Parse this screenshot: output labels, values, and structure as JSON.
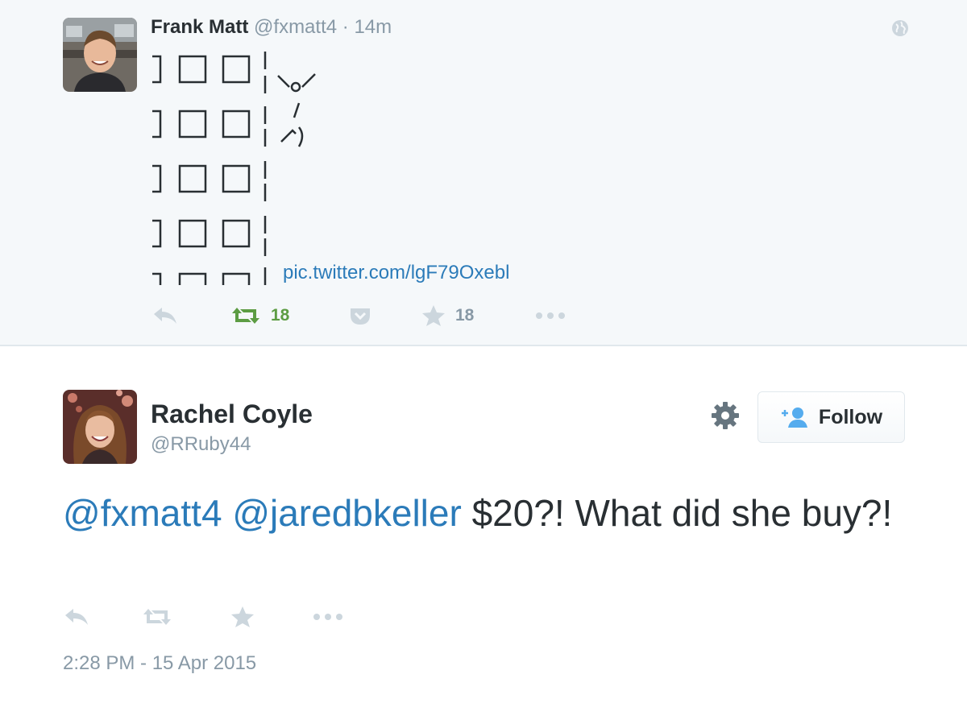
{
  "parent_tweet": {
    "name": "Frank Matt",
    "handle": "@fxmatt4",
    "separator": "·",
    "time": "14m",
    "art_lines": [
      "]□□|",
      "   |\\o/",
      "]□□| /",
      "   |ノ)",
      "]□□|",
      "   |",
      "]□□|",
      "   |",
      "┐┌┐┌┐|"
    ],
    "link": "pic.twitter.com/lgF79Oxebl",
    "retweet_count": "18",
    "favorite_count": "18",
    "icons": [
      "globe-icon",
      "reply-icon",
      "retweet-icon",
      "pocket-icon",
      "star-icon",
      "more-icon"
    ],
    "retweeted_color": "#5c9c43"
  },
  "reply_tweet": {
    "name": "Rachel Coyle",
    "handle": "@RRuby44",
    "follow_label": "Follow",
    "mention_1": "@fxmatt4",
    "mention_2": "@jaredbkeller",
    "text": " $20?! What did she buy?!",
    "timestamp": "2:28 PM - 15 Apr 2015",
    "icons": [
      "gear-icon",
      "follow-user-icon",
      "reply-icon",
      "retweet-icon",
      "star-icon",
      "more-icon"
    ]
  },
  "colors": {
    "link_blue": "#2b7bb9",
    "muted_gray": "#8899a6",
    "icon_gray": "#ccd6dd",
    "text": "#292f33"
  }
}
